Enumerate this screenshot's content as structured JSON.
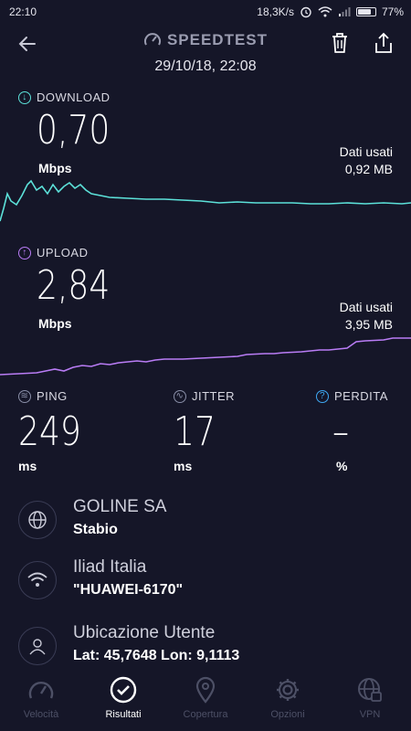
{
  "status_bar": {
    "time": "22:10",
    "speed": "18,3K/s",
    "battery": "77%",
    "battery_level": 0.77
  },
  "header": {
    "title": "SPEEDTEST",
    "datetime": "29/10/18, 22:08"
  },
  "download": {
    "label": "DOWNLOAD",
    "value": "0,70",
    "unit": "Mbps",
    "data_used_label": "Dati usati",
    "data_used_value": "0,92 MB",
    "color": "#5ce1d9"
  },
  "upload": {
    "label": "UPLOAD",
    "value": "2,84",
    "unit": "Mbps",
    "data_used_label": "Dati usati",
    "data_used_value": "3,95 MB",
    "color": "#b97cf5"
  },
  "ping": {
    "label": "PING",
    "value": "249",
    "unit": "ms"
  },
  "jitter": {
    "label": "JITTER",
    "value": "17",
    "unit": "ms"
  },
  "loss": {
    "label": "PERDITA",
    "value": "–",
    "unit": "%"
  },
  "server": {
    "title": "GOLINE SA",
    "subtitle": "Stabio"
  },
  "network": {
    "title": "Iliad Italia",
    "subtitle": "\"HUAWEI-6170\""
  },
  "location": {
    "title": "Ubicazione Utente",
    "subtitle": "Lat: 45,7648 Lon: 9,1113"
  },
  "nav": {
    "speed": "Velocità",
    "results": "Risultati",
    "coverage": "Copertura",
    "options": "Opzioni",
    "vpn": "VPN"
  },
  "icons": {
    "accent": "#5ce1d9",
    "upload_accent": "#b97cf5",
    "ping_accent": "#8a8fa8",
    "help_accent": "#3fa9f5"
  }
}
